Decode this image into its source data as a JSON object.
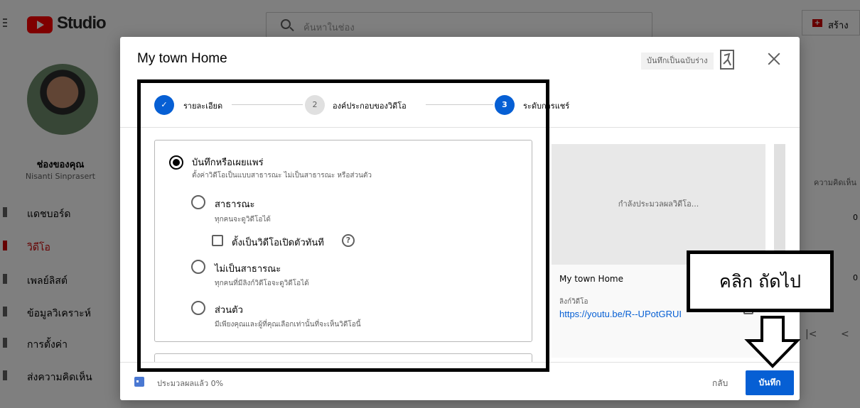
{
  "topbar": {
    "logo_text": "Studio",
    "search_placeholder": "ค้นหาในช่อง",
    "create_label": "สร้าง"
  },
  "sidebar": {
    "channel_label": "ช่องของคุณ",
    "channel_name": "Nisanti Sinprasert",
    "items": [
      {
        "label": "แดชบอร์ด",
        "active": false
      },
      {
        "label": "วิดีโอ",
        "active": true
      },
      {
        "label": "เพลย์ลิสต์",
        "active": false
      },
      {
        "label": "ข้อมูลวิเคราะห์",
        "active": false
      },
      {
        "label": "การตั้งค่า",
        "active": false
      },
      {
        "label": "ส่งความคิดเห็น",
        "active": false
      }
    ]
  },
  "right_col": {
    "header": "ความคิดเห็น",
    "row1": "0",
    "row2": "0",
    "first_page": "|<",
    "prev_page": "<"
  },
  "dialog": {
    "title": "My town Home",
    "draft_chip": "บันทึกเป็นฉบับร่าง",
    "steps": [
      {
        "label": "รายละเอียด",
        "state": "done",
        "num": "✓"
      },
      {
        "label": "องค์ประกอบของวิดีโอ",
        "state": "pending",
        "num": "2"
      },
      {
        "label": "ระดับการแชร์",
        "state": "current",
        "num": "3"
      }
    ],
    "visibility": {
      "main_title": "บันทึกหรือเผยแพร่",
      "main_sub": "ตั้งค่าวิดีโอเป็นแบบสาธารณะ ไม่เป็นสาธารณะ หรือส่วนตัว",
      "public_title": "สาธารณะ",
      "public_sub": "ทุกคนจะดูวิดีโอได้",
      "premiere_label": "ตั้งเป็นวิดีโอเปิดตัวทันที",
      "unlisted_title": "ไม่เป็นสาธารณะ",
      "unlisted_sub": "ทุกคนที่มีลิงก์วิดีโอจะดูวิดีโอได้",
      "private_title": "ส่วนตัว",
      "private_sub": "มีเพียงคุณและผู้ที่คุณเลือกเท่านั้นที่จะเห็นวิดีโอนี้"
    },
    "preview": {
      "processing_text": "กำลังประมวลผลวิดีโอ...",
      "title": "My town Home",
      "link_label": "ลิงก์วิดีโอ",
      "link": "https://youtu.be/R--UPotGRUI"
    },
    "footer": {
      "processed": "ประมวลผลแล้ว 0%",
      "back": "กลับ",
      "save": "บันทึก"
    }
  },
  "annotation": {
    "callout_text": "คลิก ถัดไป"
  }
}
